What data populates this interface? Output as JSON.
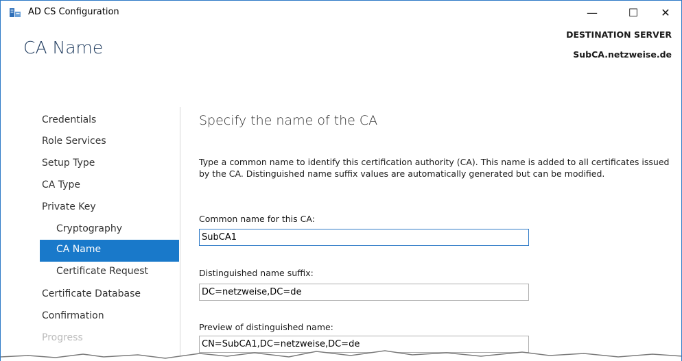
{
  "window": {
    "title": "AD CS Configuration",
    "controls": {
      "minimize": "—",
      "maximize": "☐",
      "close": "✕"
    }
  },
  "header": {
    "page_title": "CA Name",
    "destination_label": "DESTINATION SERVER",
    "destination_server": "SubCA.netzweise.de"
  },
  "nav": {
    "items": [
      {
        "label": "Credentials",
        "state": "normal"
      },
      {
        "label": "Role Services",
        "state": "normal"
      },
      {
        "label": "Setup Type",
        "state": "normal"
      },
      {
        "label": "CA Type",
        "state": "normal"
      },
      {
        "label": "Private Key",
        "state": "normal"
      },
      {
        "label": "Cryptography",
        "state": "normal"
      },
      {
        "label": "CA Name",
        "state": "active"
      },
      {
        "label": "Certificate Request",
        "state": "normal"
      },
      {
        "label": "Certificate Database",
        "state": "normal"
      },
      {
        "label": "Confirmation",
        "state": "normal"
      },
      {
        "label": "Progress",
        "state": "disabled"
      }
    ]
  },
  "main": {
    "section_title": "Specify the name of the CA",
    "description": "Type a common name to identify this certification authority (CA). This name is added to all certificates issued by the CA. Distinguished name suffix values are automatically generated but can be modified.",
    "common_name": {
      "label": "Common name for this CA:",
      "value": "SubCA1"
    },
    "dn_suffix": {
      "label": "Distinguished name suffix:",
      "value": "DC=netzweise,DC=de"
    },
    "dn_preview": {
      "label": "Preview of distinguished name:",
      "value": "CN=SubCA1,DC=netzweise,DC=de"
    }
  },
  "colors": {
    "accent": "#1979ca",
    "title_blue": "#1f3b5e",
    "border_focus": "#2b78c6"
  }
}
